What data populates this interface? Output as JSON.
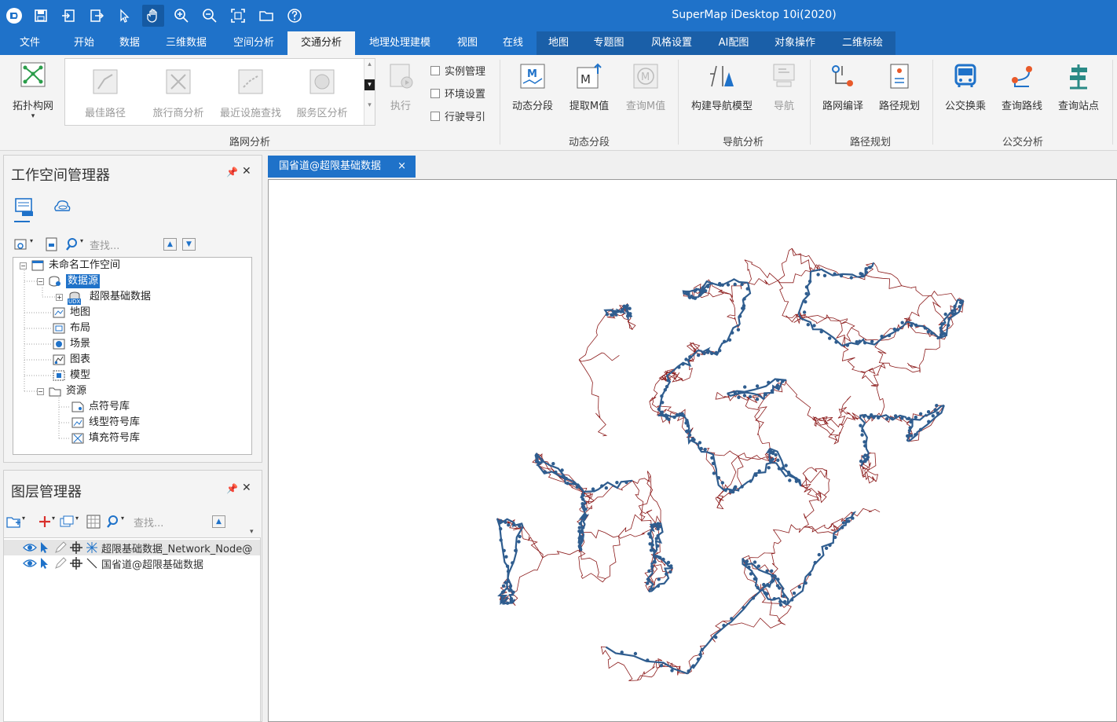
{
  "app": {
    "title": "SuperMap iDesktop 10i(2020)"
  },
  "quick_access": [
    "logo-icon",
    "save-icon",
    "import-icon",
    "export-icon",
    "select-icon",
    "pan-icon",
    "zoom-in-icon",
    "zoom-out-icon",
    "full-extent-icon",
    "open-folder-icon",
    "help-icon"
  ],
  "tabs": [
    {
      "label": "文件"
    },
    {
      "label": "开始"
    },
    {
      "label": "数据"
    },
    {
      "label": "三维数据"
    },
    {
      "label": "空间分析"
    },
    {
      "label": "交通分析"
    },
    {
      "label": "地理处理建模"
    },
    {
      "label": "视图"
    },
    {
      "label": "在线"
    },
    {
      "label": "地图"
    },
    {
      "label": "专题图"
    },
    {
      "label": "风格设置"
    },
    {
      "label": "AI配图"
    },
    {
      "label": "对象操作"
    },
    {
      "label": "二维标绘"
    }
  ],
  "ribbon": {
    "topology": "拓扑构网",
    "gallery": [
      "最佳路径",
      "旅行商分析",
      "最近设施查找",
      "服务区分析"
    ],
    "execute": "执行",
    "checks": [
      "实例管理",
      "环境设置",
      "行驶导引"
    ],
    "network_group": "路网分析",
    "dynamic": {
      "segment": "动态分段",
      "extract_m": "提取M值",
      "query_m": "查询M值",
      "group": "动态分段"
    },
    "nav": {
      "build": "构建导航模型",
      "navigate": "导航",
      "group": "导航分析"
    },
    "route": {
      "compile": "路网编译",
      "plan": "路径规划",
      "group": "路径规划"
    },
    "transit": {
      "transfer": "公交换乘",
      "query_line": "查询路线",
      "query_stop": "查询站点",
      "group": "公交分析"
    }
  },
  "workspace": {
    "title": "工作空间管理器",
    "search_placeholder": "查找...",
    "tree": {
      "root": "未命名工作空间",
      "datasource": "数据源",
      "udx": "超限基础数据",
      "udx_badge": "UDX",
      "map": "地图",
      "layout": "布局",
      "scene": "场景",
      "chart": "图表",
      "model": "模型",
      "resources": "资源",
      "point_lib": "点符号库",
      "line_lib": "线型符号库",
      "fill_lib": "填充符号库"
    }
  },
  "layers": {
    "title": "图层管理器",
    "search_placeholder": "查找...",
    "items": [
      "超限基础数据_Network_Node@",
      "国省道@超限基础数据"
    ]
  },
  "map": {
    "tab_label": "国省道@超限基础数据",
    "tab_close": "×",
    "colors": {
      "roads": "#8b1a1a",
      "network": "#2f5d8f"
    }
  }
}
